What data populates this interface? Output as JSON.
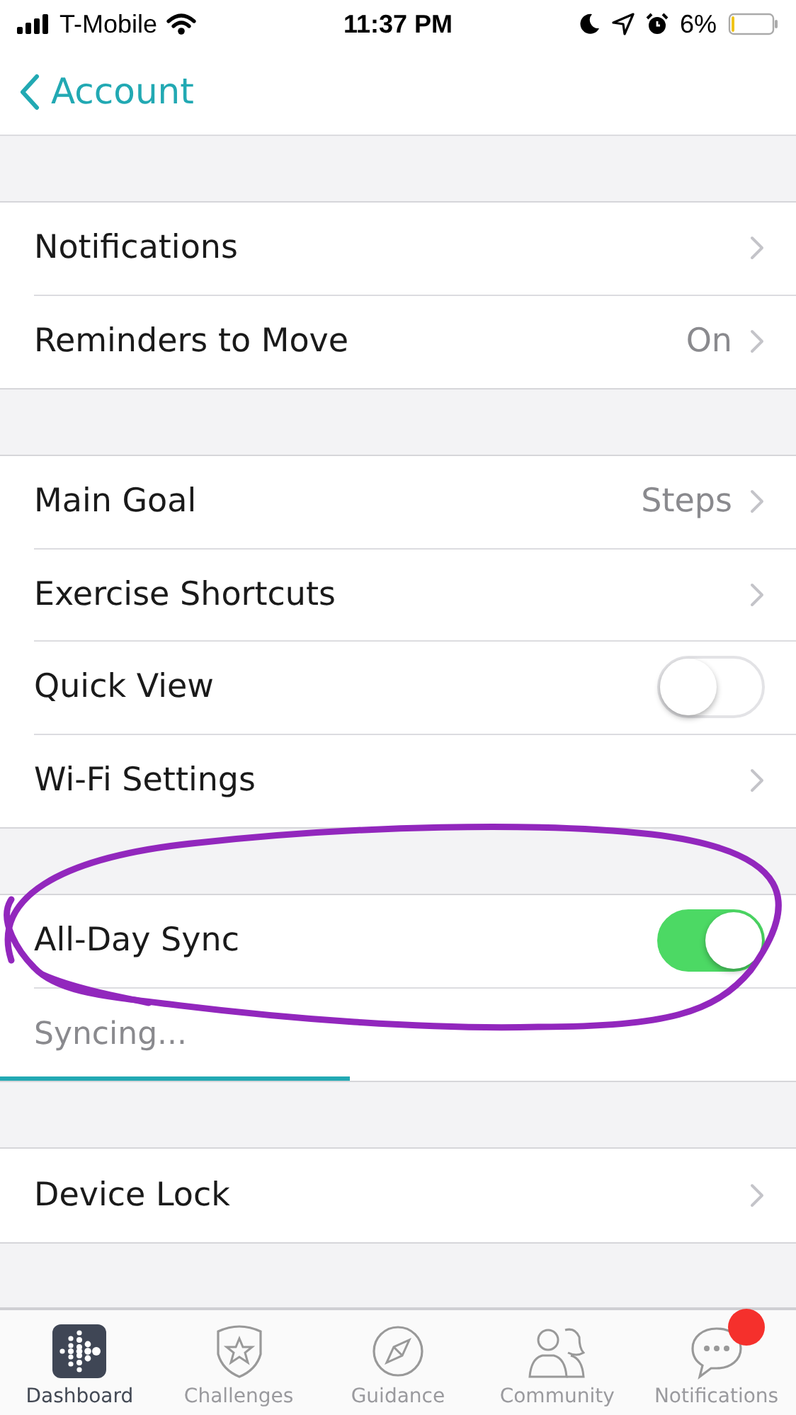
{
  "status_bar": {
    "carrier": "T-Mobile",
    "time": "11:37 PM",
    "battery": "6%"
  },
  "nav": {
    "back": "Account"
  },
  "sections": [
    {
      "rows": [
        {
          "kind": "link",
          "label": "Notifications"
        },
        {
          "kind": "link",
          "label": "Reminders to Move",
          "value": "On"
        }
      ]
    },
    {
      "rows": [
        {
          "kind": "link",
          "label": "Main Goal",
          "value": "Steps"
        },
        {
          "kind": "link",
          "label": "Exercise Shortcuts"
        },
        {
          "kind": "toggle",
          "label": "Quick View",
          "on": false
        },
        {
          "kind": "link",
          "label": "Wi-Fi Settings"
        }
      ]
    },
    {
      "rows": [
        {
          "kind": "toggle",
          "label": "All-Day Sync",
          "on": true
        },
        {
          "kind": "progress",
          "label": "Syncing...",
          "level": 0.44
        }
      ]
    },
    {
      "rows": [
        {
          "kind": "link",
          "label": "Device Lock"
        }
      ]
    }
  ],
  "tab_bar": [
    {
      "kind": "dashboard",
      "label": "Dashboard",
      "selected": true,
      "badge": false
    },
    {
      "kind": "challenges",
      "label": "Challenges",
      "selected": false,
      "badge": false
    },
    {
      "kind": "guidance",
      "label": "Guidance",
      "selected": false,
      "badge": false
    },
    {
      "kind": "community",
      "label": "Community",
      "selected": false,
      "badge": false
    },
    {
      "kind": "notifications",
      "label": "Notifications",
      "selected": false,
      "badge": true
    }
  ]
}
